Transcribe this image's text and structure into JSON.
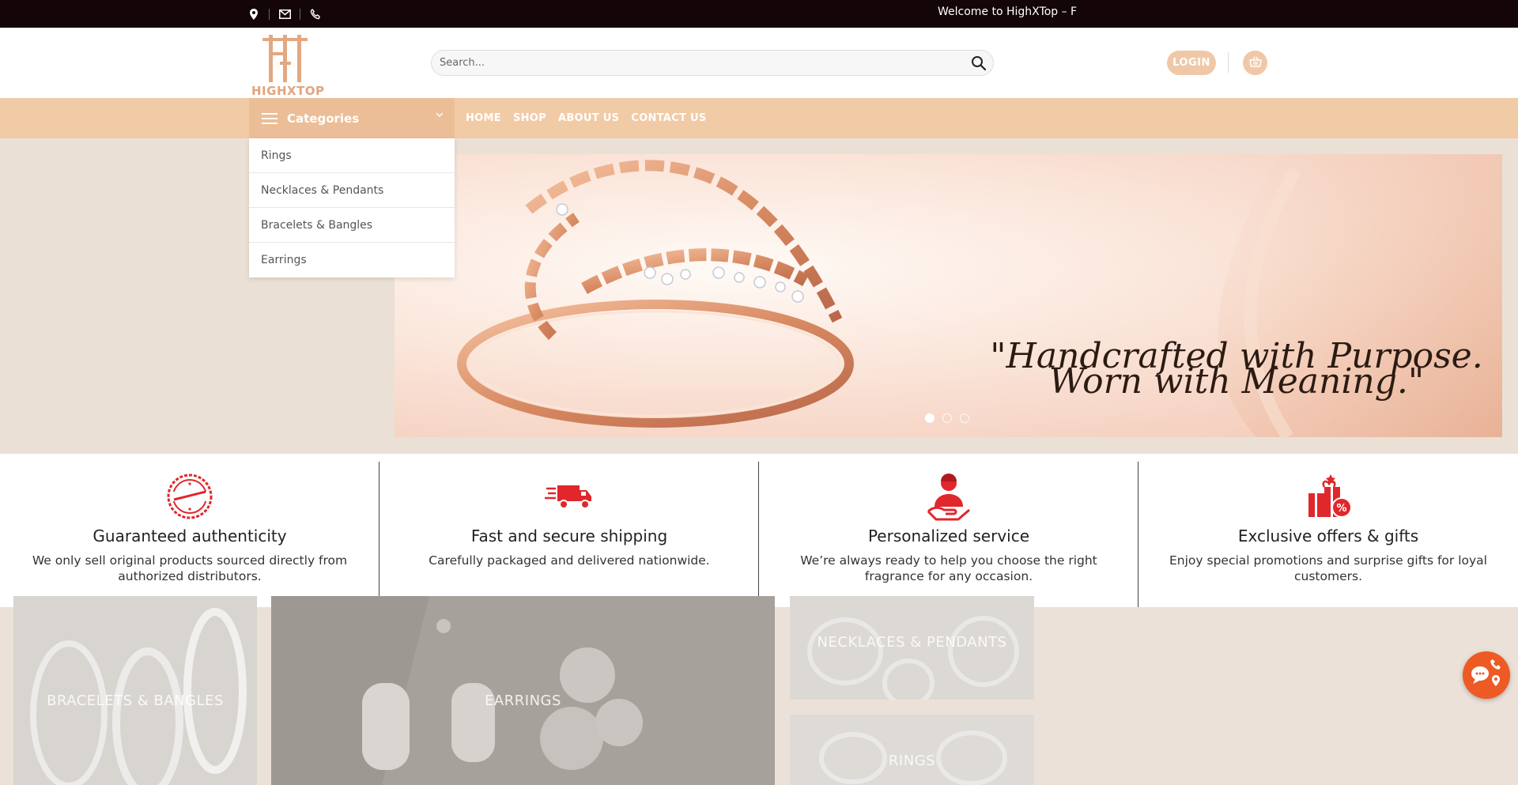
{
  "topbar": {
    "welcome": "Welcome to HighXTop – F",
    "icons": [
      "location-icon",
      "mail-icon",
      "phone-icon"
    ]
  },
  "header": {
    "logo_text": "HIGHXTOP",
    "search_placeholder": "Search...",
    "login_label": "LOGIN"
  },
  "nav": {
    "categories_label": "Categories",
    "links": [
      "HOME",
      "SHOP",
      "ABOUT US",
      "CONTACT US"
    ]
  },
  "categories": [
    "Rings",
    "Necklaces & Pendants",
    "Bracelets & Bangles",
    "Earrings"
  ],
  "hero": {
    "quote": "\"Handcrafted with Purpose. Worn with Meaning.\"",
    "slide_count": 3,
    "active_slide": 1
  },
  "features": [
    {
      "icon": "authentic-badge-icon",
      "title": "Guaranteed authenticity",
      "text": "We only sell original products sourced directly from authorized distributors."
    },
    {
      "icon": "delivery-truck-icon",
      "title": "Fast and secure shipping",
      "text": "Carefully packaged and delivered nationwide."
    },
    {
      "icon": "customer-service-icon",
      "title": "Personalized service",
      "text": "We’re always ready to help you choose the right fragrance for any occasion."
    },
    {
      "icon": "gift-offer-icon",
      "title": "Exclusive offers & gifts",
      "text": "Enjoy special promotions and surprise gifts for loyal customers."
    }
  ],
  "tiles": {
    "bracelets": "BRACELETS & BANGLES",
    "earrings": "EARRINGS",
    "necklaces": "NECKLACES & PENDANTS",
    "rings": "RINGS"
  },
  "colors": {
    "topbar": "#140508",
    "nav": "#f1cba6",
    "accent": "#f0c8a8",
    "icon_red": "#e0272b",
    "float": "#ee5a24"
  }
}
